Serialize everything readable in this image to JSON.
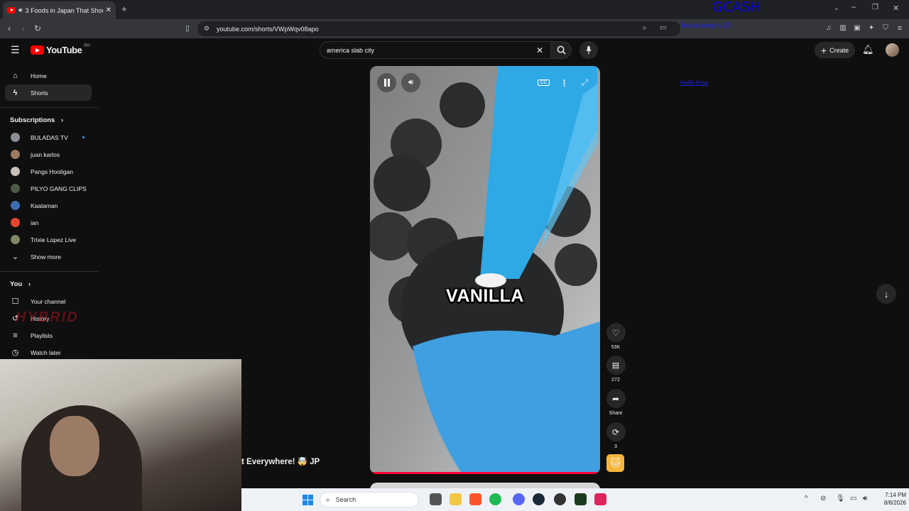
{
  "browser": {
    "tab_title": "3 Foods in Japan That Should...",
    "url": "youtube.com/shorts/VWpWqv08apo"
  },
  "header": {
    "logo_text": "YouTube",
    "country_code": "PH",
    "search_value": "america slab city",
    "create_label": "Create"
  },
  "sidebar": {
    "main": [
      {
        "label": "Home",
        "icon": "home-icon"
      },
      {
        "label": "Shorts",
        "icon": "shorts-icon"
      }
    ],
    "subscriptions_heading": "Subscriptions",
    "subscriptions": [
      {
        "label": "BULADAS TV",
        "color": "#8a8f96"
      },
      {
        "label": "juan karlos",
        "color": "#9c7b63"
      },
      {
        "label": "Pangs Hooligan",
        "color": "#c7c2b8"
      },
      {
        "label": "PILYO GANG CLIPS",
        "color": "#4e5a47"
      },
      {
        "label": "Kaalaman",
        "color": "#3b6db5"
      },
      {
        "label": "ian",
        "color": "#e8452c"
      },
      {
        "label": "Trixie Lopez Live",
        "color": "#7d8a66"
      }
    ],
    "show_more": "Show more",
    "you_heading": "You",
    "you_items": [
      {
        "label": "Your channel"
      },
      {
        "label": "History"
      },
      {
        "label": "Playlists"
      },
      {
        "label": "Watch later"
      }
    ]
  },
  "player": {
    "caption": "VANILLA",
    "progress": 1.0
  },
  "actions": {
    "likes": "53K",
    "comments": "272",
    "share_label": "Share",
    "remix_count": "3"
  },
  "overlay": {
    "gcash": "GCASH",
    "donor_line": "hosaiseeph 20",
    "sub_line": "hsdfa hcsa",
    "ticker": "t Everywhere! 🤯 JP",
    "watermark": "HYBRID"
  },
  "taskbar": {
    "search_placeholder": "Search",
    "time": "7:14 PM",
    "date": "8/8/2026"
  }
}
